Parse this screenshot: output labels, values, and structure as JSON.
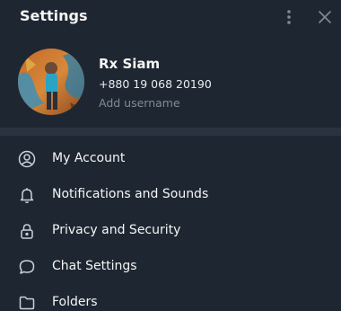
{
  "header": {
    "title": "Settings",
    "menu_icon": "vertical-dots-icon",
    "close_icon": "close-icon"
  },
  "profile": {
    "name": "Rx Siam",
    "phone": "+880 19 068 20190",
    "username_placeholder": "Add username"
  },
  "menu": {
    "items": [
      {
        "label": "My Account",
        "icon": "user-circle-icon"
      },
      {
        "label": "Notifications and Sounds",
        "icon": "bell-icon"
      },
      {
        "label": "Privacy and Security",
        "icon": "lock-icon"
      },
      {
        "label": "Chat Settings",
        "icon": "chat-bubble-icon"
      },
      {
        "label": "Folders",
        "icon": "folder-icon"
      }
    ]
  },
  "colors": {
    "background": "#1e2731",
    "divider": "#28333f",
    "text": "#f5f5f5",
    "muted": "#7f8b96",
    "icon": "#c9d1d9"
  }
}
